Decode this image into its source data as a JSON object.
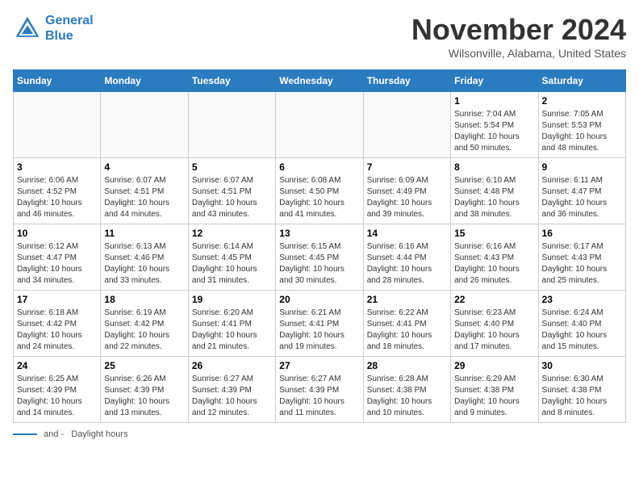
{
  "header": {
    "logo_line1": "General",
    "logo_line2": "Blue",
    "month_title": "November 2024",
    "location": "Wilsonville, Alabama, United States"
  },
  "days_of_week": [
    "Sunday",
    "Monday",
    "Tuesday",
    "Wednesday",
    "Thursday",
    "Friday",
    "Saturday"
  ],
  "weeks": [
    [
      {
        "day": "",
        "info": ""
      },
      {
        "day": "",
        "info": ""
      },
      {
        "day": "",
        "info": ""
      },
      {
        "day": "",
        "info": ""
      },
      {
        "day": "",
        "info": ""
      },
      {
        "day": "1",
        "info": "Sunrise: 7:04 AM\nSunset: 5:54 PM\nDaylight: 10 hours\nand 50 minutes."
      },
      {
        "day": "2",
        "info": "Sunrise: 7:05 AM\nSunset: 5:53 PM\nDaylight: 10 hours\nand 48 minutes."
      }
    ],
    [
      {
        "day": "3",
        "info": "Sunrise: 6:06 AM\nSunset: 4:52 PM\nDaylight: 10 hours\nand 46 minutes."
      },
      {
        "day": "4",
        "info": "Sunrise: 6:07 AM\nSunset: 4:51 PM\nDaylight: 10 hours\nand 44 minutes."
      },
      {
        "day": "5",
        "info": "Sunrise: 6:07 AM\nSunset: 4:51 PM\nDaylight: 10 hours\nand 43 minutes."
      },
      {
        "day": "6",
        "info": "Sunrise: 6:08 AM\nSunset: 4:50 PM\nDaylight: 10 hours\nand 41 minutes."
      },
      {
        "day": "7",
        "info": "Sunrise: 6:09 AM\nSunset: 4:49 PM\nDaylight: 10 hours\nand 39 minutes."
      },
      {
        "day": "8",
        "info": "Sunrise: 6:10 AM\nSunset: 4:48 PM\nDaylight: 10 hours\nand 38 minutes."
      },
      {
        "day": "9",
        "info": "Sunrise: 6:11 AM\nSunset: 4:47 PM\nDaylight: 10 hours\nand 36 minutes."
      }
    ],
    [
      {
        "day": "10",
        "info": "Sunrise: 6:12 AM\nSunset: 4:47 PM\nDaylight: 10 hours\nand 34 minutes."
      },
      {
        "day": "11",
        "info": "Sunrise: 6:13 AM\nSunset: 4:46 PM\nDaylight: 10 hours\nand 33 minutes."
      },
      {
        "day": "12",
        "info": "Sunrise: 6:14 AM\nSunset: 4:45 PM\nDaylight: 10 hours\nand 31 minutes."
      },
      {
        "day": "13",
        "info": "Sunrise: 6:15 AM\nSunset: 4:45 PM\nDaylight: 10 hours\nand 30 minutes."
      },
      {
        "day": "14",
        "info": "Sunrise: 6:16 AM\nSunset: 4:44 PM\nDaylight: 10 hours\nand 28 minutes."
      },
      {
        "day": "15",
        "info": "Sunrise: 6:16 AM\nSunset: 4:43 PM\nDaylight: 10 hours\nand 26 minutes."
      },
      {
        "day": "16",
        "info": "Sunrise: 6:17 AM\nSunset: 4:43 PM\nDaylight: 10 hours\nand 25 minutes."
      }
    ],
    [
      {
        "day": "17",
        "info": "Sunrise: 6:18 AM\nSunset: 4:42 PM\nDaylight: 10 hours\nand 24 minutes."
      },
      {
        "day": "18",
        "info": "Sunrise: 6:19 AM\nSunset: 4:42 PM\nDaylight: 10 hours\nand 22 minutes."
      },
      {
        "day": "19",
        "info": "Sunrise: 6:20 AM\nSunset: 4:41 PM\nDaylight: 10 hours\nand 21 minutes."
      },
      {
        "day": "20",
        "info": "Sunrise: 6:21 AM\nSunset: 4:41 PM\nDaylight: 10 hours\nand 19 minutes."
      },
      {
        "day": "21",
        "info": "Sunrise: 6:22 AM\nSunset: 4:41 PM\nDaylight: 10 hours\nand 18 minutes."
      },
      {
        "day": "22",
        "info": "Sunrise: 6:23 AM\nSunset: 4:40 PM\nDaylight: 10 hours\nand 17 minutes."
      },
      {
        "day": "23",
        "info": "Sunrise: 6:24 AM\nSunset: 4:40 PM\nDaylight: 10 hours\nand 15 minutes."
      }
    ],
    [
      {
        "day": "24",
        "info": "Sunrise: 6:25 AM\nSunset: 4:39 PM\nDaylight: 10 hours\nand 14 minutes."
      },
      {
        "day": "25",
        "info": "Sunrise: 6:26 AM\nSunset: 4:39 PM\nDaylight: 10 hours\nand 13 minutes."
      },
      {
        "day": "26",
        "info": "Sunrise: 6:27 AM\nSunset: 4:39 PM\nDaylight: 10 hours\nand 12 minutes."
      },
      {
        "day": "27",
        "info": "Sunrise: 6:27 AM\nSunset: 4:39 PM\nDaylight: 10 hours\nand 11 minutes."
      },
      {
        "day": "28",
        "info": "Sunrise: 6:28 AM\nSunset: 4:38 PM\nDaylight: 10 hours\nand 10 minutes."
      },
      {
        "day": "29",
        "info": "Sunrise: 6:29 AM\nSunset: 4:38 PM\nDaylight: 10 hours\nand 9 minutes."
      },
      {
        "day": "30",
        "info": "Sunrise: 6:30 AM\nSunset: 4:38 PM\nDaylight: 10 hours\nand 8 minutes."
      }
    ]
  ],
  "legend": {
    "line1": "and -",
    "line2": "Daylight hours"
  }
}
